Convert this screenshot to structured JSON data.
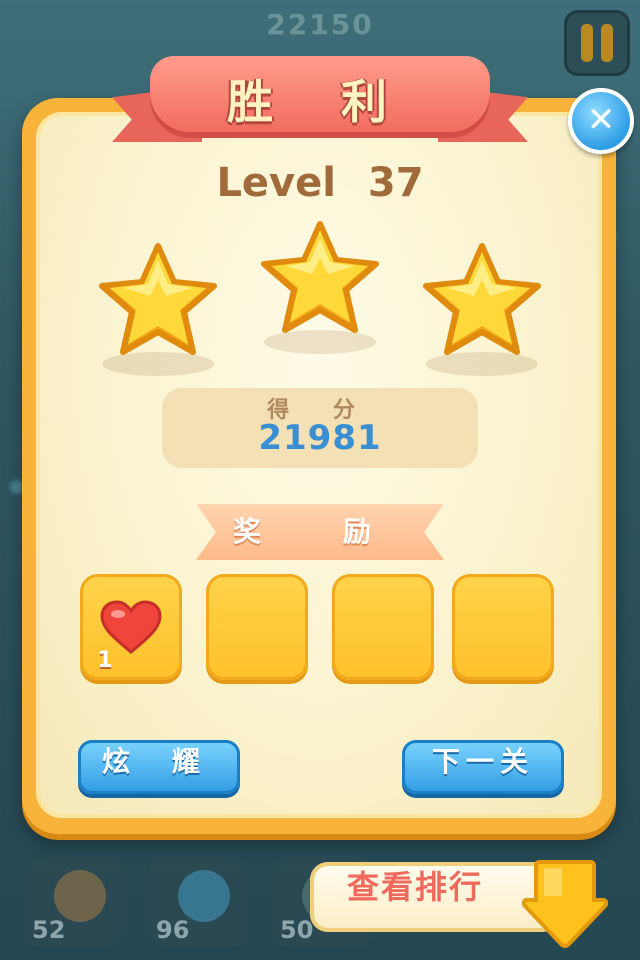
{
  "header": {
    "top_score": "22150"
  },
  "dialog": {
    "title": "胜 利",
    "level_text": "Level 37",
    "stars_earned": 3,
    "stars_total": 3,
    "score_label": "得 分",
    "score_value": "21981",
    "reward_title": "奖 励",
    "rewards": [
      {
        "icon": "heart-icon",
        "count": "1"
      },
      {
        "icon": "",
        "count": ""
      },
      {
        "icon": "",
        "count": ""
      },
      {
        "icon": "",
        "count": ""
      }
    ],
    "show_off_label": "炫 耀",
    "next_level_label": "下一关"
  },
  "toolbar": {
    "items": [
      {
        "icon": "hammer-icon",
        "count": "52"
      },
      {
        "icon": "swirl-icon",
        "count": "96"
      },
      {
        "icon": "booster-icon",
        "count": "50"
      }
    ],
    "rank_label": "查看排行"
  },
  "colors": {
    "panel_orange": "#f8b33a",
    "ribbon_red": "#f06a5c",
    "button_blue": "#2f9be3",
    "score_blue": "#3a8fd3",
    "slot_yellow": "#ffc12a"
  }
}
